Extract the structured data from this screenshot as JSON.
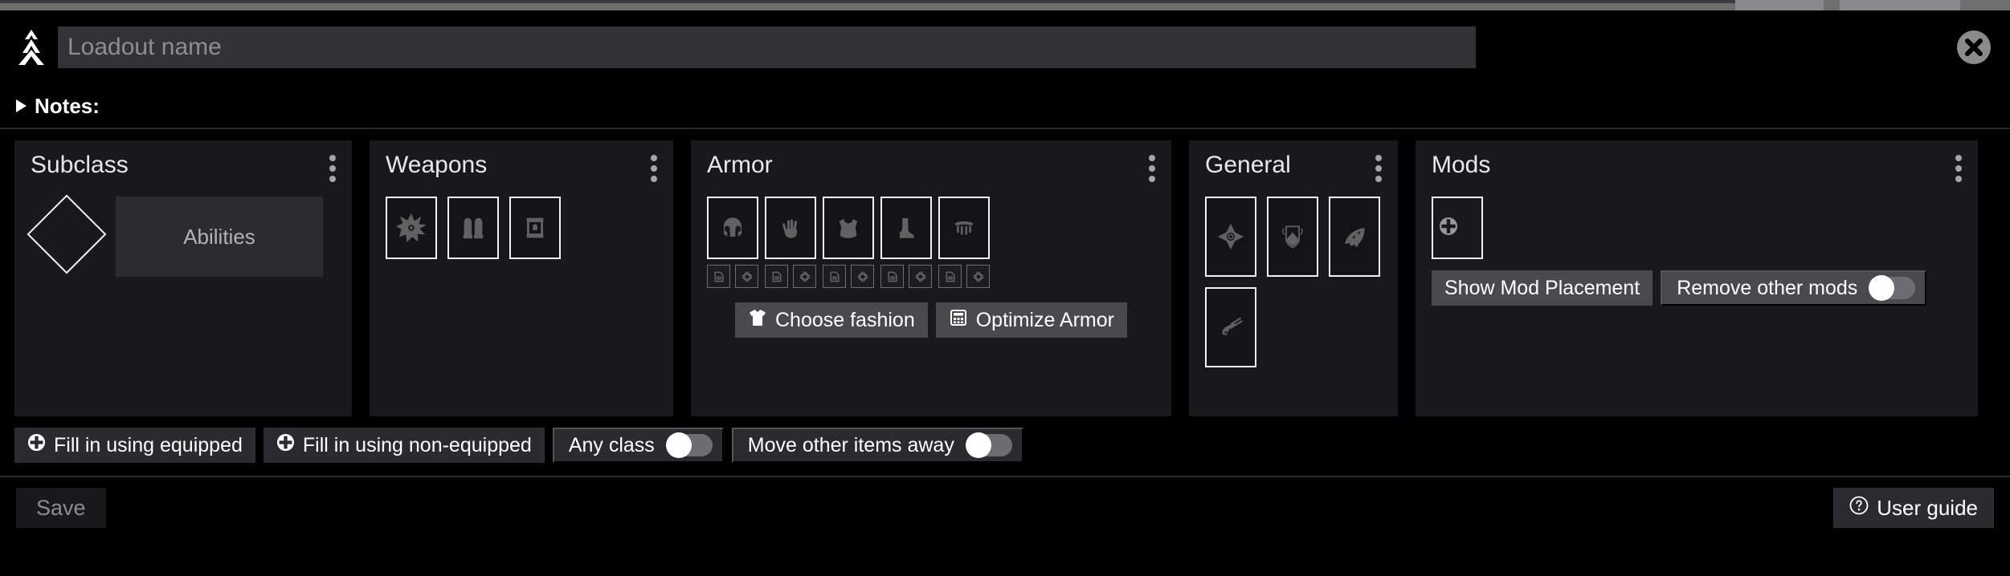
{
  "app": {
    "logo_icon": "dim-logo-icon"
  },
  "header": {
    "name_input_value": "",
    "name_input_placeholder": "Loadout name",
    "close_icon": "close-circle-icon"
  },
  "notes": {
    "label": "Notes:",
    "disclosure_icon": "triangle-right-icon",
    "expanded": false
  },
  "buckets": {
    "subclass": {
      "title": "Subclass",
      "menu_icon": "kebab-menu-icon",
      "subclass_slot_icon": "subclass-diamond-icon",
      "abilities_label": "Abilities"
    },
    "weapons": {
      "title": "Weapons",
      "menu_icon": "kebab-menu-icon",
      "slots": [
        {
          "name": "kinetic-weapon-slot",
          "icon": "kinetic-burst-icon"
        },
        {
          "name": "energy-weapon-slot",
          "icon": "energy-bullets-icon"
        },
        {
          "name": "power-weapon-slot",
          "icon": "power-ammo-crate-icon"
        }
      ]
    },
    "armor": {
      "title": "Armor",
      "menu_icon": "kebab-menu-icon",
      "slots": [
        {
          "name": "helmet-slot",
          "icon": "helmet-icon"
        },
        {
          "name": "gauntlets-slot",
          "icon": "gauntlets-hand-icon"
        },
        {
          "name": "chest-armor-slot",
          "icon": "chest-armor-icon"
        },
        {
          "name": "leg-armor-slot",
          "icon": "boot-icon"
        },
        {
          "name": "class-item-slot",
          "icon": "class-item-icon"
        }
      ],
      "socket_icons": [
        "armor-shader-socket-icon",
        "armor-mod-socket-icon"
      ],
      "choose_fashion_label": "Choose fashion",
      "choose_fashion_icon": "tshirt-icon",
      "optimize_armor_label": "Optimize Armor",
      "optimize_armor_icon": "calculator-icon"
    },
    "general": {
      "title": "General",
      "menu_icon": "kebab-menu-icon",
      "slots": [
        {
          "name": "ghost-slot",
          "icon": "ghost-icon"
        },
        {
          "name": "emblem-slot",
          "icon": "emblem-banner-icon"
        },
        {
          "name": "ship-slot",
          "icon": "ship-icon"
        },
        {
          "name": "sparrow-slot",
          "icon": "sparrow-icon"
        }
      ]
    },
    "mods": {
      "title": "Mods",
      "menu_icon": "kebab-menu-icon",
      "add_mod_icon": "plus-circle-icon",
      "show_mod_placement_label": "Show Mod Placement",
      "remove_other_mods_label": "Remove other mods",
      "remove_other_mods_on": false
    }
  },
  "toolbar": {
    "fill_equipped_label": "Fill in using equipped",
    "fill_equipped_icon": "plus-circle-icon",
    "fill_non_equipped_label": "Fill in using non-equipped",
    "fill_non_equipped_icon": "plus-circle-icon",
    "any_class_label": "Any class",
    "any_class_on": false,
    "move_other_items_label": "Move other items away",
    "move_other_items_on": false
  },
  "footer": {
    "save_label": "Save",
    "save_disabled": true,
    "user_guide_label": "User guide",
    "user_guide_icon": "question-circle-icon"
  },
  "colors": {
    "background": "#000000",
    "panel": "#19191b",
    "panel_alt": "#2c2c2e",
    "button": "#4a4a4c",
    "button_dark": "#2b2b2d",
    "text": "#ffffff",
    "text_muted": "#8d8d8d",
    "slot_border": "#f2f2f2",
    "switch_track": "#6d6d6f",
    "switch_knob": "#ffffff"
  }
}
